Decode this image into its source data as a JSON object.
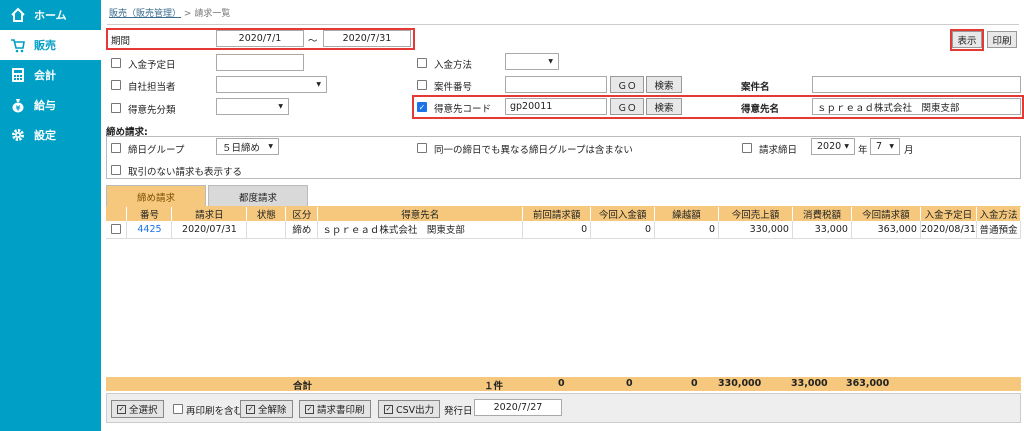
{
  "sidebar": {
    "items": [
      {
        "label": "ホーム",
        "icon": "home-icon"
      },
      {
        "label": "販売",
        "icon": "cart-icon"
      },
      {
        "label": "会計",
        "icon": "calculator-icon"
      },
      {
        "label": "給与",
        "icon": "money-bag-icon"
      },
      {
        "label": "設定",
        "icon": "gear-icon"
      }
    ],
    "active_color": "#00a0c6"
  },
  "breadcrumb": {
    "link": "販売（販売管理）",
    "sep": ">",
    "current": "請求一覧"
  },
  "filters": {
    "period_label": "期間",
    "date_from": "2020/7/1",
    "tilde": "～",
    "date_to": "2020/7/31",
    "show_button": "表示",
    "print_button": "印刷",
    "due_date_label": "入金予定日",
    "payment_method_label": "入金方法",
    "staff_label": "自社担当者",
    "project_no_label": "案件番号",
    "go_label": "ＧＯ",
    "search_label": "検索",
    "project_name_label": "案件名",
    "client_cat_label": "得意先分類",
    "client_code_label": "得意先コード",
    "client_code_value": "gp20011",
    "client_name_label": "得意先名",
    "client_name_value": "ｓｐｒｅａｄ株式会社　関東支部"
  },
  "closing": {
    "title": "締め請求:",
    "group_label": "締日グループ",
    "group_value": "５日締め",
    "same_day_label": "同一の締日でも異なる締日グループは含まない",
    "bill_date_label": "請求締日",
    "year_value": "2020",
    "year_unit": "年",
    "month_value": "7",
    "month_unit": "月",
    "no_txn_label": "取引のない請求も表示する"
  },
  "tabs": [
    "締め請求",
    "都度請求"
  ],
  "table": {
    "headers": [
      "番号",
      "請求日",
      "状態",
      "区分",
      "得意先名",
      "前回請求額",
      "今回入金額",
      "繰越額",
      "今回売上額",
      "消費税額",
      "今回請求額",
      "入金予定日",
      "入金方法"
    ],
    "rows": [
      [
        "4425",
        "2020/07/31",
        "",
        "締め",
        "ｓｐｒｅａｄ株式会社　関東支部",
        "0",
        "0",
        "0",
        "330,000",
        "33,000",
        "363,000",
        "2020/08/31",
        "普通預金"
      ]
    ]
  },
  "footer": {
    "total_label": "合計",
    "count": "１件",
    "prev": "0",
    "paid": "0",
    "carry": "0",
    "sales": "330,000",
    "tax": "33,000",
    "billed": "363,000"
  },
  "toolbar": {
    "select_all": "全選択",
    "reprint": "再印刷を含む",
    "clear_all": "全解除",
    "print_invoice": "請求書印刷",
    "csv": "CSV出力",
    "issue_date_label": "発行日",
    "issue_date": "2020/7/27"
  }
}
